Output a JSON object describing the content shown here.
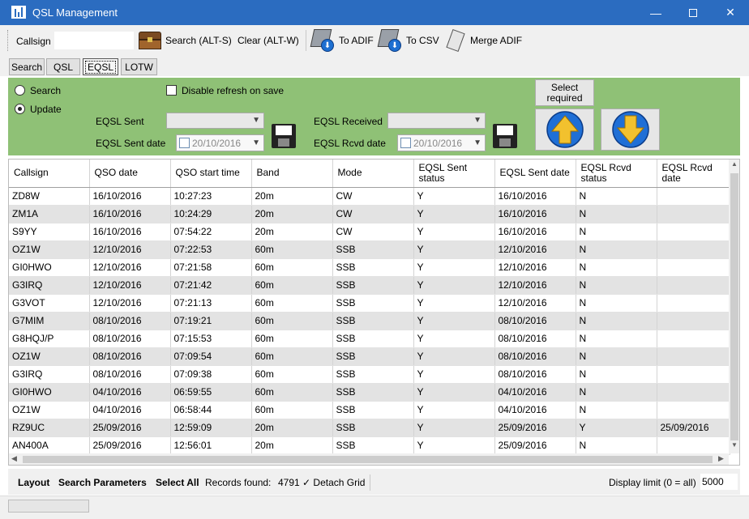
{
  "window": {
    "title": "QSL Management",
    "minimize": "—",
    "close": "✕"
  },
  "toolbar": {
    "callsign_label": "Callsign",
    "callsign_value": "",
    "search_label": "Search (ALT-S)",
    "clear_label": "Clear (ALT-W)",
    "to_adif_label": "To ADIF",
    "to_csv_label": "To CSV",
    "merge_adif_label": "Merge ADIF"
  },
  "tabs": [
    {
      "label": "Search",
      "active": false
    },
    {
      "label": "QSL",
      "active": false
    },
    {
      "label": "EQSL",
      "active": true
    },
    {
      "label": "LOTW",
      "active": false
    }
  ],
  "panel": {
    "radio_search": "Search",
    "radio_update": "Update",
    "radio_selected": "Update",
    "disable_refresh": "Disable refresh on save",
    "disable_refresh_checked": false,
    "eqsl_sent_label": "EQSL Sent",
    "eqsl_sent_value": "",
    "eqsl_sent_date_label": "EQSL Sent date",
    "eqsl_sent_date_value": "20/10/2016",
    "eqsl_received_label": "EQSL Received",
    "eqsl_received_value": "",
    "eqsl_rcvd_date_label": "EQSL Rcvd date",
    "eqsl_rcvd_date_value": "20/10/2016",
    "select_required_label": "Select required",
    "accent_color": "#8fc176"
  },
  "grid": {
    "columns": [
      "Callsign",
      "QSO date",
      "QSO start time",
      "Band",
      "Mode",
      "EQSL Sent status",
      "EQSL Sent date",
      "EQSL Rcvd status",
      "EQSL Rcvd date"
    ],
    "rows": [
      [
        "ZD8W",
        "16/10/2016",
        "10:27:23",
        "20m",
        "CW",
        "Y",
        "16/10/2016",
        "N",
        ""
      ],
      [
        "ZM1A",
        "16/10/2016",
        "10:24:29",
        "20m",
        "CW",
        "Y",
        "16/10/2016",
        "N",
        ""
      ],
      [
        "S9YY",
        "16/10/2016",
        "07:54:22",
        "20m",
        "CW",
        "Y",
        "16/10/2016",
        "N",
        ""
      ],
      [
        "OZ1W",
        "12/10/2016",
        "07:22:53",
        "60m",
        "SSB",
        "Y",
        "12/10/2016",
        "N",
        ""
      ],
      [
        "GI0HWO",
        "12/10/2016",
        "07:21:58",
        "60m",
        "SSB",
        "Y",
        "12/10/2016",
        "N",
        ""
      ],
      [
        "G3IRQ",
        "12/10/2016",
        "07:21:42",
        "60m",
        "SSB",
        "Y",
        "12/10/2016",
        "N",
        ""
      ],
      [
        "G3VOT",
        "12/10/2016",
        "07:21:13",
        "60m",
        "SSB",
        "Y",
        "12/10/2016",
        "N",
        ""
      ],
      [
        "G7MIM",
        "08/10/2016",
        "07:19:21",
        "60m",
        "SSB",
        "Y",
        "08/10/2016",
        "N",
        ""
      ],
      [
        "G8HQJ/P",
        "08/10/2016",
        "07:15:53",
        "60m",
        "SSB",
        "Y",
        "08/10/2016",
        "N",
        ""
      ],
      [
        "OZ1W",
        "08/10/2016",
        "07:09:54",
        "60m",
        "SSB",
        "Y",
        "08/10/2016",
        "N",
        ""
      ],
      [
        "G3IRQ",
        "08/10/2016",
        "07:09:38",
        "60m",
        "SSB",
        "Y",
        "08/10/2016",
        "N",
        ""
      ],
      [
        "GI0HWO",
        "04/10/2016",
        "06:59:55",
        "60m",
        "SSB",
        "Y",
        "04/10/2016",
        "N",
        ""
      ],
      [
        "OZ1W",
        "04/10/2016",
        "06:58:44",
        "60m",
        "SSB",
        "Y",
        "04/10/2016",
        "N",
        ""
      ],
      [
        "RZ9UC",
        "25/09/2016",
        "12:59:09",
        "20m",
        "SSB",
        "Y",
        "25/09/2016",
        "Y",
        "25/09/2016"
      ],
      [
        "AN400A",
        "25/09/2016",
        "12:56:01",
        "20m",
        "SSB",
        "Y",
        "25/09/2016",
        "N",
        ""
      ]
    ]
  },
  "bottombar": {
    "layout_label": "Layout",
    "search_params_label": "Search Parameters",
    "select_all_label": "Select All",
    "records_found_label": "Records found:",
    "records_found_value": "4791",
    "detach_grid_label": "Detach Grid",
    "detach_grid_check": "✓",
    "display_limit_label": "Display limit (0 = all)",
    "display_limit_value": "5000"
  }
}
